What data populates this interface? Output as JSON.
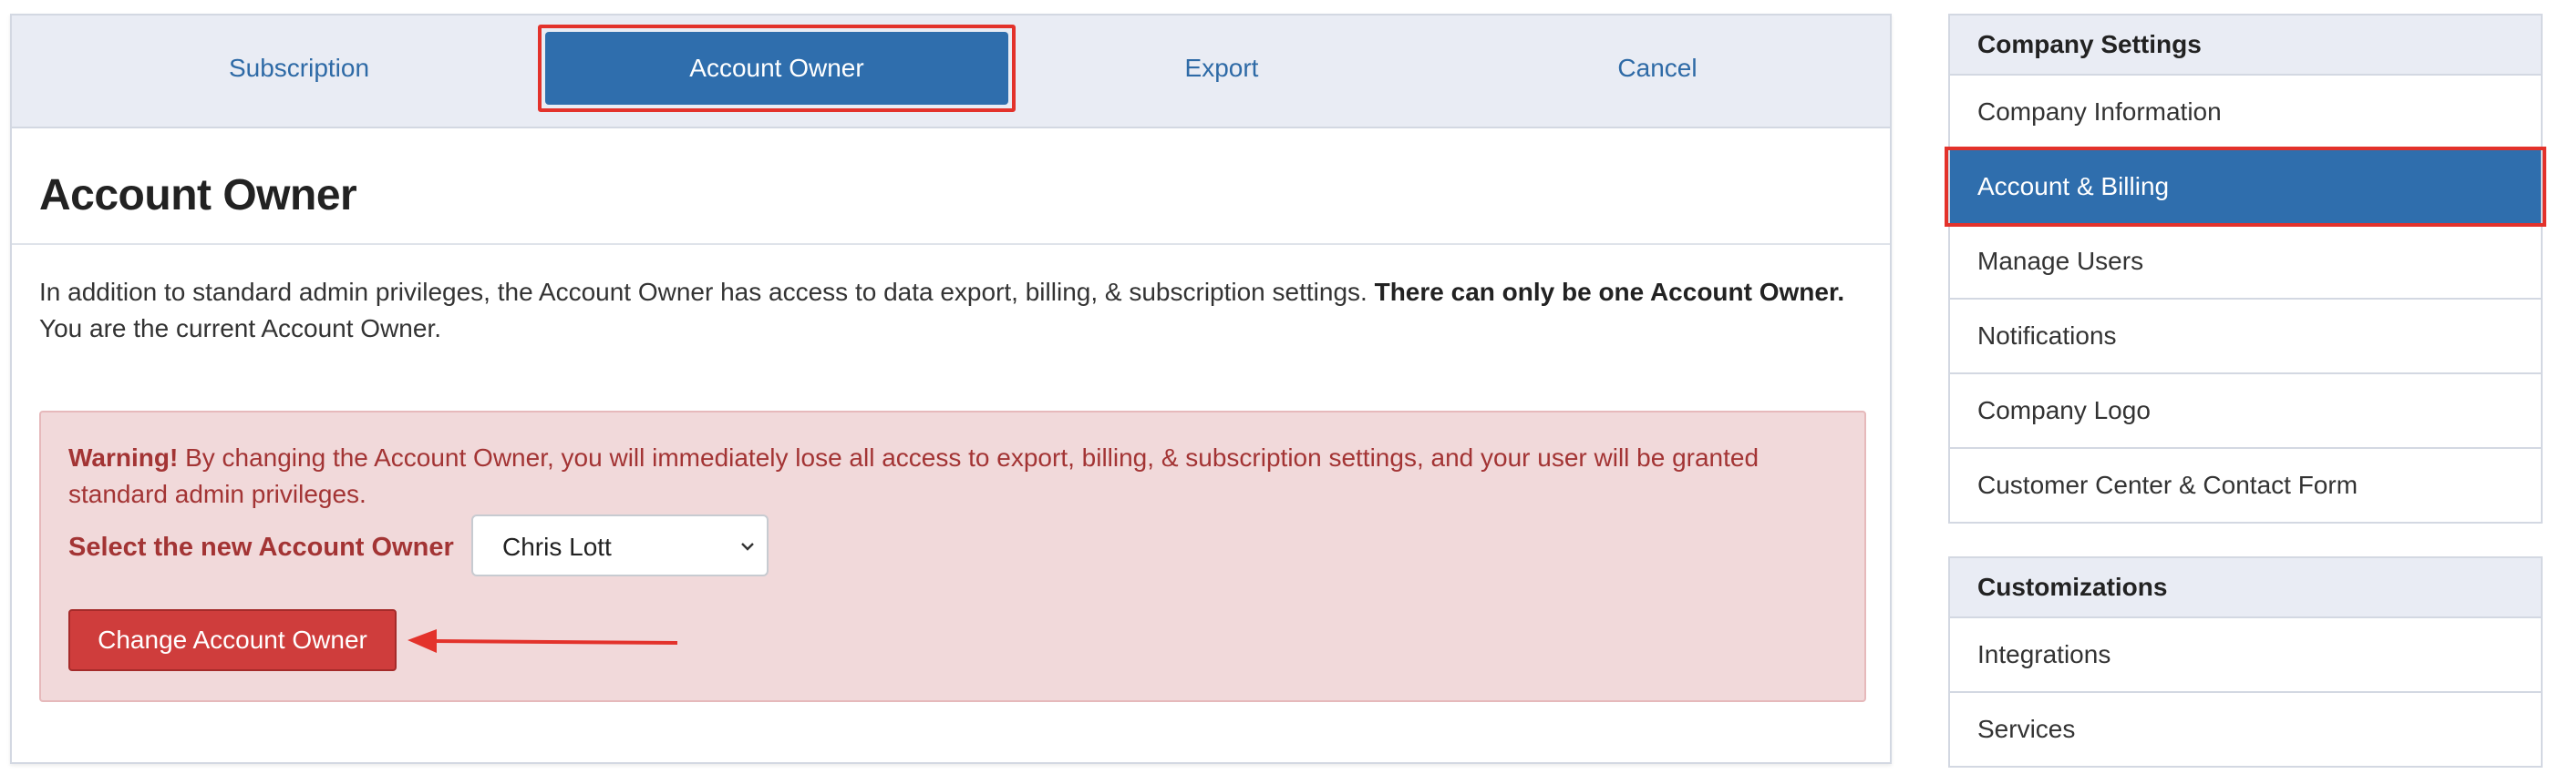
{
  "tabs": [
    {
      "label": "Subscription",
      "active": false
    },
    {
      "label": "Account Owner",
      "active": true
    },
    {
      "label": "Export",
      "active": false
    },
    {
      "label": "Cancel",
      "active": false
    }
  ],
  "page": {
    "title": "Account Owner",
    "intro_text": "In addition to standard admin privileges, the Account Owner has access to data export, billing, & subscription settings.",
    "intro_bold": "There can only be one Account Owner.",
    "intro_suffix": "You are the current Account Owner."
  },
  "warning": {
    "prefix": "Warning!",
    "text": "By changing the Account Owner, you will immediately lose all access to export, billing, & subscription settings, and your user will be granted standard admin privileges.",
    "select_label": "Select the new Account Owner",
    "select_value": "Chris Lott",
    "button_label": "Change Account Owner"
  },
  "sidebar": {
    "company_settings": {
      "title": "Company Settings",
      "items": [
        {
          "label": "Company Information",
          "active": false
        },
        {
          "label": "Account & Billing",
          "active": true
        },
        {
          "label": "Manage Users",
          "active": false
        },
        {
          "label": "Notifications",
          "active": false
        },
        {
          "label": "Company Logo",
          "active": false
        },
        {
          "label": "Customer Center & Contact Form",
          "active": false
        }
      ]
    },
    "customizations": {
      "title": "Customizations",
      "items": [
        {
          "label": "Integrations",
          "active": false
        },
        {
          "label": "Services",
          "active": false
        }
      ]
    }
  },
  "colors": {
    "accent": "#2f6ead",
    "highlight": "#e3322b",
    "warning_bg": "#f1d9da",
    "warning_text": "#a33434",
    "danger_button": "#cf3d3c"
  },
  "icons": {
    "select_caret": "chevron-down-icon",
    "annotation_arrow": "arrow-left-icon"
  }
}
